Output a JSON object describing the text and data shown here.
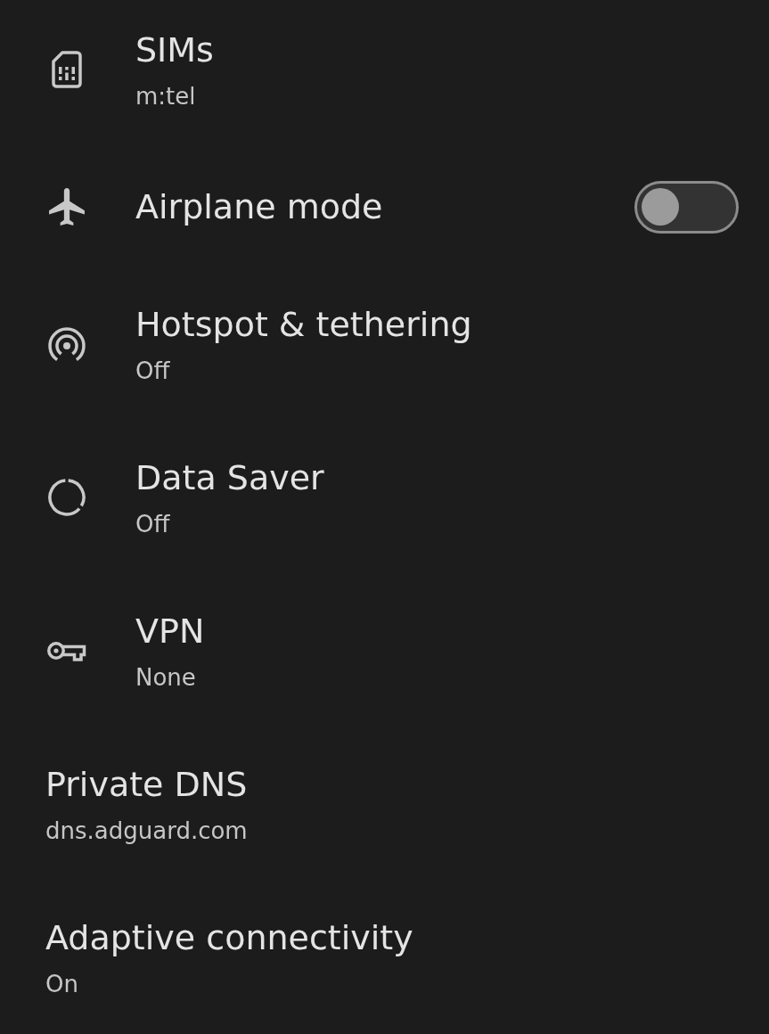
{
  "settings": [
    {
      "kind": "sim",
      "title": "SIMs",
      "subtitle": "m:tel"
    },
    {
      "kind": "airplane",
      "title": "Airplane mode",
      "toggle": {
        "on": false
      }
    },
    {
      "kind": "hotspot",
      "title": "Hotspot & tethering",
      "subtitle": "Off"
    },
    {
      "kind": "data-saver",
      "title": "Data Saver",
      "subtitle": "Off"
    },
    {
      "kind": "vpn",
      "title": "VPN",
      "subtitle": "None"
    },
    {
      "kind": "plain",
      "title": "Private DNS",
      "subtitle": "dns.adguard.com"
    },
    {
      "kind": "plain",
      "title": "Adaptive connectivity",
      "subtitle": "On"
    }
  ]
}
